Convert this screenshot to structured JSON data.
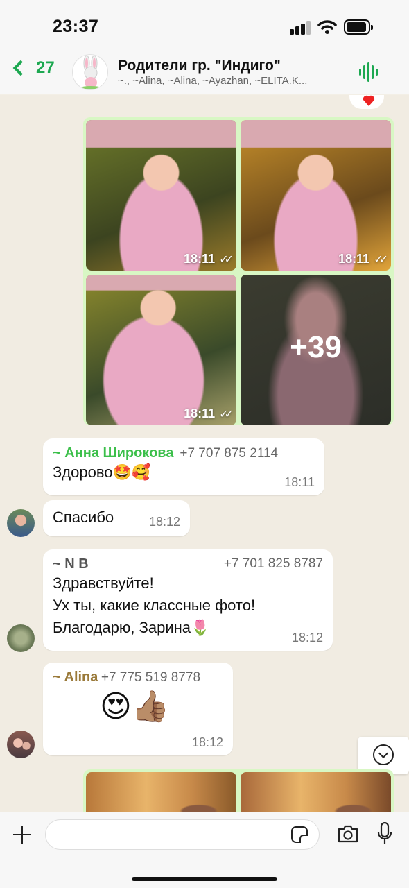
{
  "status": {
    "time": "23:37"
  },
  "header": {
    "back_count": "27",
    "title": "Родители гр. \"Индиго\"",
    "subtitle": "~., ~Alina, ~Alina, ~Ayazhan, ~ELITA.K..."
  },
  "album": {
    "photos": [
      {
        "time": "18:11"
      },
      {
        "time": "18:11"
      },
      {
        "time": "18:11"
      },
      {
        "more": "+39"
      }
    ]
  },
  "messages": [
    {
      "sender": "~ Анна Широкова",
      "sender_color": "#3bbf4a",
      "phone": "+7 707 875 2114",
      "text": "Здорово🤩🥰",
      "time": "18:11"
    },
    {
      "text": "Спасибо",
      "time": "18:12"
    },
    {
      "sender": "~ N B",
      "sender_color": "#555555",
      "phone": "+7 701 825 8787",
      "text": "Здравствуйте!\nУх ты, какие классные фото!\nБлагодарю, Зарина🌷",
      "time": "18:12"
    },
    {
      "sender": "~ Alina",
      "sender_color": "#9a7a3a",
      "phone": "+7 775 519 8778",
      "text": "😍👍🏽",
      "time": "18:12"
    }
  ],
  "input": {
    "placeholder": ""
  },
  "colors": {
    "accent": "#1da851",
    "album_bg": "#d8f7c4",
    "chat_bg": "#f1ece2"
  }
}
